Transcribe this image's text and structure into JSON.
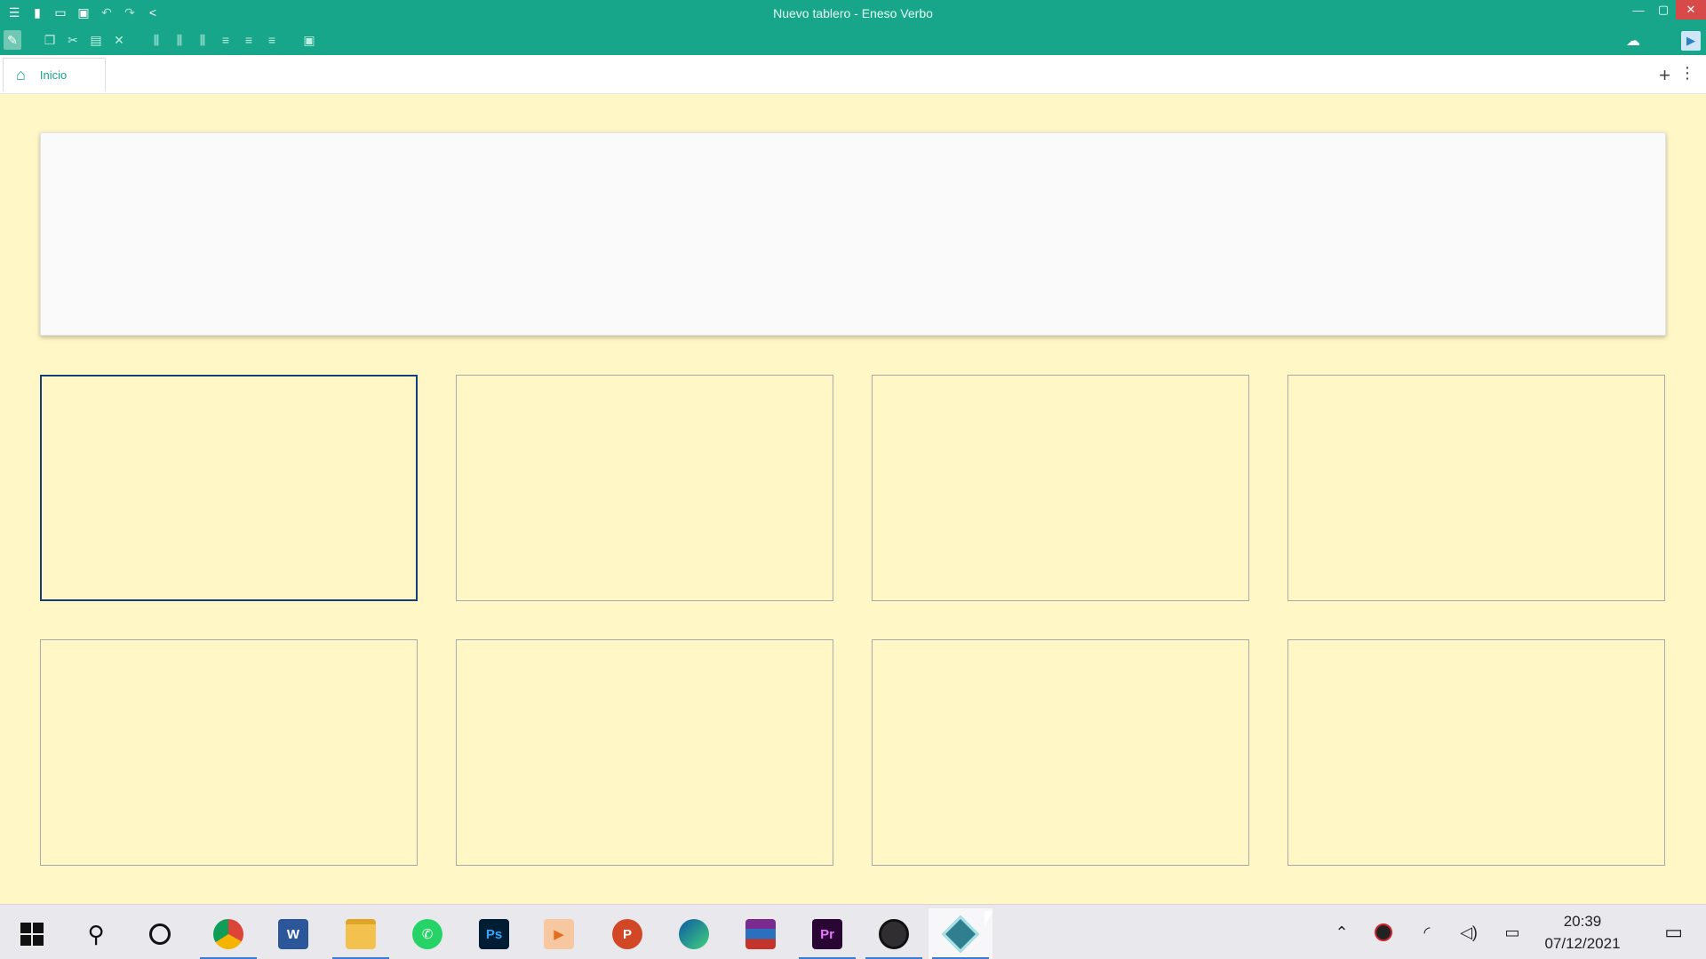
{
  "window": {
    "title": "Nuevo tablero - Eneso Verbo",
    "menu_icon": "hamburger-icon",
    "quick_actions": [
      "new-file-icon",
      "open-folder-icon",
      "save-icon",
      "undo-icon",
      "redo-icon",
      "share-icon"
    ]
  },
  "toolbar": {
    "tools": [
      "edit-icon",
      "copy-icon",
      "cut-icon",
      "paste-icon",
      "delete-icon",
      "align-left-icon",
      "align-center-icon",
      "align-right-icon",
      "align-top-icon",
      "align-middle-icon",
      "align-bottom-icon",
      "fill-icon"
    ],
    "cloud_icon": "cloud-upload-icon",
    "play_icon": "play-icon"
  },
  "tabs": {
    "items": [
      {
        "label": "Inicio",
        "icon": "home-icon"
      }
    ],
    "add_label": "+",
    "more_label": "⋮"
  },
  "board": {
    "grid": {
      "rows": 2,
      "columns": 4,
      "selected_index": 0
    },
    "colors": {
      "background": "#fff7c6",
      "accent": "#17a689",
      "selected_border": "#123f7a"
    }
  },
  "taskbar": {
    "apps": [
      "start-icon",
      "search-icon",
      "cortana-icon",
      "chrome-icon",
      "word-icon",
      "file-explorer-icon",
      "whatsapp-icon",
      "photoshop-icon",
      "media-player-icon",
      "powerpoint-icon",
      "edge-icon",
      "winrar-icon",
      "premiere-icon",
      "obs-icon",
      "eneso-verbo-icon"
    ],
    "app_labels": {
      "word": "W",
      "photoshop": "Ps",
      "powerpoint": "P",
      "premiere": "Pr"
    },
    "tray": [
      "chevron-up-icon",
      "security-icon",
      "wifi-icon",
      "volume-icon",
      "battery-icon"
    ],
    "time": "20:39",
    "date": "07/12/2021",
    "notification_icon": "notification-icon"
  }
}
